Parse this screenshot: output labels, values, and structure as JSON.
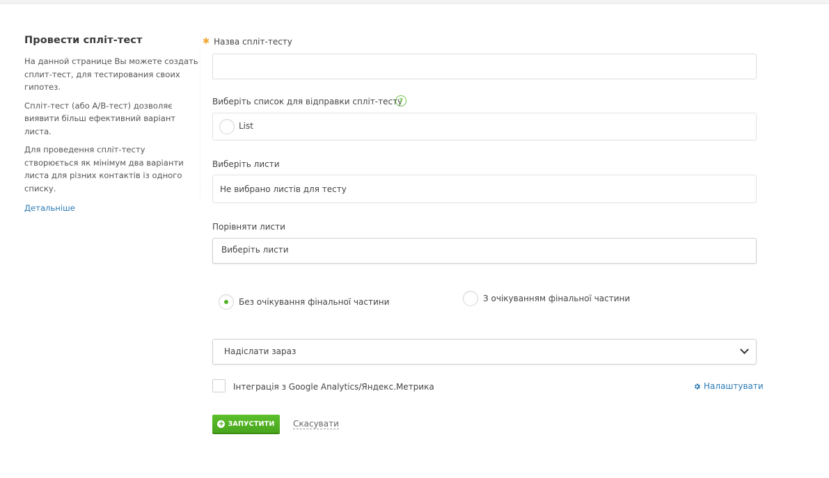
{
  "sidebar": {
    "title": "Провести спліт-тест",
    "paragraphs": [
      "На данной странице Вы можете создать сплит-тест, для тестирования своих гипотез.",
      "Спліт-тест (або A/B-тест) дозволяє виявити більш ефективний варіант листа.",
      "Для проведення спліт-тесту створюється як мінімум два варіанти листа для різних контактів із одного списку."
    ],
    "more_link": "Детальніше"
  },
  "form": {
    "name_label": "Назва спліт-тесту",
    "name_value": "",
    "list_label": "Виберіть список для відправки спліт-тесту",
    "help_glyph": "?",
    "list_option": "List",
    "letters_label": "Виберіть листи",
    "letters_value": "Не вибрано листів для тесту",
    "compare_label": "Порівняти листи",
    "compare_value": "Виберіть листи",
    "radio_without": "Без очікування фінальної частини",
    "radio_with": "З очікуванням фінальної частини",
    "send_select": "Надіслати зараз",
    "analytics_label": "Інтеграція з Google Analytics/Яндекс.Метрика",
    "settings_link": "Налаштувати",
    "run_button": "ЗАПУСТИТИ",
    "cancel_link": "Скасувати"
  },
  "colors": {
    "accent_green": "#55b32a",
    "link_blue": "#2a7ab5",
    "required_star": "#f0a830"
  },
  "icons": [
    "help-icon",
    "gear-icon",
    "plus-circle-icon",
    "chevron-down-icon"
  ]
}
